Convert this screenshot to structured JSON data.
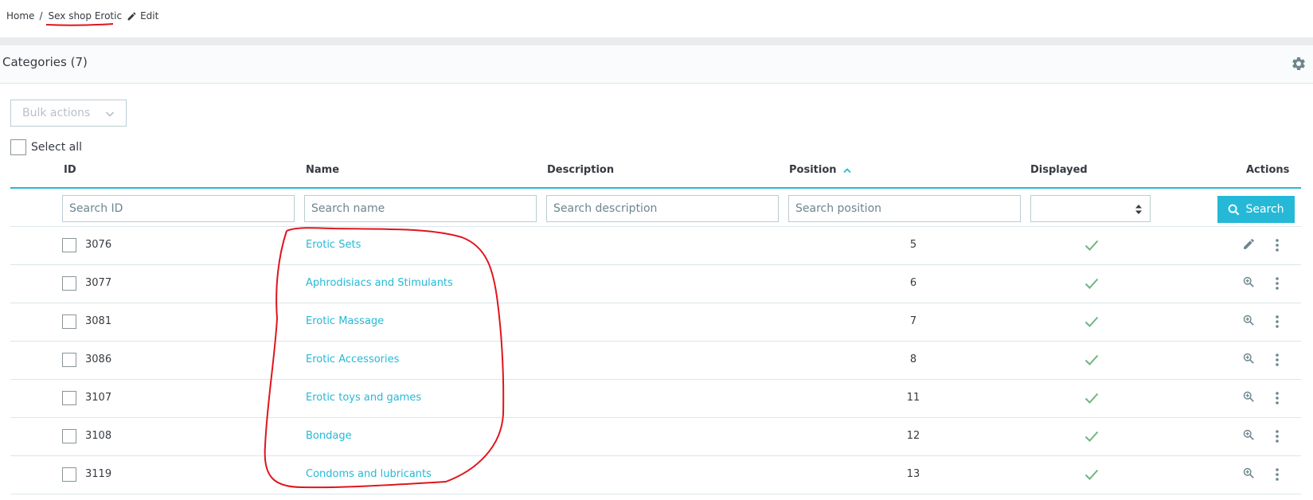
{
  "breadcrumb": {
    "home": "Home",
    "separator": "/",
    "current": "Sex shop Erotic",
    "edit": "Edit"
  },
  "panel": {
    "title": "Categories (7)"
  },
  "bulk_actions": {
    "label": "Bulk actions"
  },
  "select_all": {
    "label": "Select all"
  },
  "table": {
    "columns": {
      "id": "ID",
      "name": "Name",
      "description": "Description",
      "position": "Position",
      "displayed": "Displayed",
      "actions": "Actions"
    },
    "filters": {
      "id_placeholder": "Search ID",
      "name_placeholder": "Search name",
      "description_placeholder": "Search description",
      "position_placeholder": "Search position",
      "search_button": "Search"
    },
    "rows": [
      {
        "id": "3076",
        "name": "Erotic Sets",
        "position": "5",
        "displayed": true,
        "action": "edit"
      },
      {
        "id": "3077",
        "name": "Aphrodisiacs and Stimulants",
        "position": "6",
        "displayed": true,
        "action": "view"
      },
      {
        "id": "3081",
        "name": "Erotic Massage",
        "position": "7",
        "displayed": true,
        "action": "view"
      },
      {
        "id": "3086",
        "name": "Erotic Accessories",
        "position": "8",
        "displayed": true,
        "action": "view"
      },
      {
        "id": "3107",
        "name": "Erotic toys and games",
        "position": "11",
        "displayed": true,
        "action": "view"
      },
      {
        "id": "3108",
        "name": "Bondage",
        "position": "12",
        "displayed": true,
        "action": "view"
      },
      {
        "id": "3119",
        "name": "Condoms and lubricants",
        "position": "13",
        "displayed": true,
        "action": "view"
      }
    ]
  },
  "colors": {
    "accent": "#25b9d7",
    "success": "#70b580",
    "annotation": "#e0141c"
  },
  "icons": {
    "edit": "pencil-icon",
    "view": "zoom-in-icon",
    "more": "kebab-icon",
    "settings": "gear-icon",
    "sort": "chevron-up-icon",
    "displayed": "check-icon"
  }
}
